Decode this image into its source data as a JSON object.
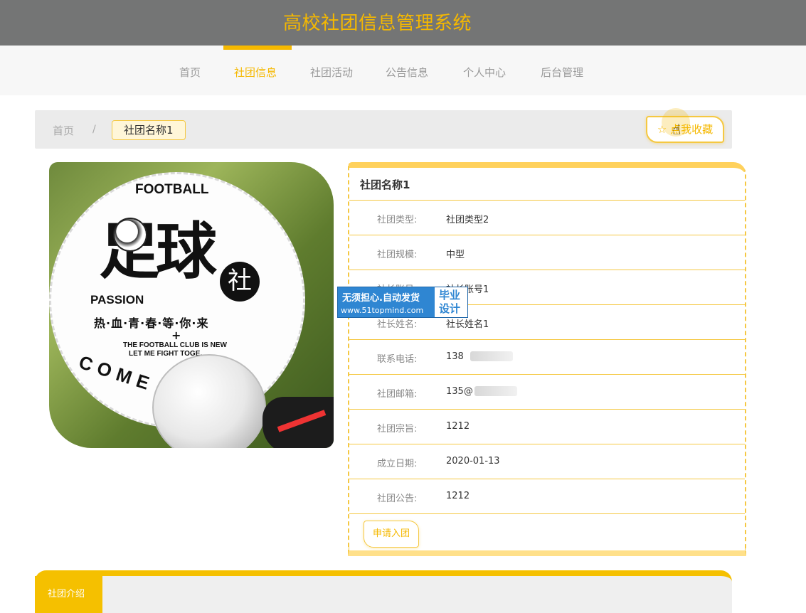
{
  "header": {
    "title": "高校社团信息管理系统"
  },
  "nav": {
    "items": [
      {
        "label": "首页",
        "active": false
      },
      {
        "label": "社团信息",
        "active": true
      },
      {
        "label": "社团活动",
        "active": false
      },
      {
        "label": "公告信息",
        "active": false
      },
      {
        "label": "个人中心",
        "active": false
      },
      {
        "label": "后台管理",
        "active": false
      }
    ]
  },
  "breadcrumb": {
    "home": "首页",
    "separator": "/",
    "current": "社团名称1"
  },
  "favorite_button": {
    "label": "☆ 点我收藏"
  },
  "poster": {
    "football": "FOOTBALL",
    "big_chars": "足球",
    "seal": "社",
    "passion": "PASSION",
    "slogan": "热·血·青·春·等·你·来",
    "plus": "+",
    "en_line1": "THE FOOTBALL CLUB IS NEW",
    "en_line2": "LET ME FIGHT TOGE...",
    "come": "COME"
  },
  "club": {
    "name": "社团名称1",
    "fields": [
      {
        "label": "社团类型:",
        "value": "社团类型2"
      },
      {
        "label": "社团规模:",
        "value": "中型"
      },
      {
        "label": "社长账号:",
        "value": "社长账号1"
      },
      {
        "label": "社长姓名:",
        "value": "社长姓名1"
      },
      {
        "label": "联系电话:",
        "value": "138"
      },
      {
        "label": "社团邮箱:",
        "value": "135@"
      },
      {
        "label": "社团宗旨:",
        "value": "1212"
      },
      {
        "label": "成立日期:",
        "value": "2020-01-13"
      },
      {
        "label": "社团公告:",
        "value": "1212"
      }
    ],
    "apply_label": "申请入团"
  },
  "watermark": {
    "line1": "无须担心.自动发货",
    "line2": "www.51topmind.com",
    "side1": "毕业",
    "side2": "设计"
  },
  "description": {
    "tab_label": "社团介绍"
  },
  "colors": {
    "accent": "#f5b800",
    "topbar": "#747575",
    "watermark": "#2f86d2"
  }
}
